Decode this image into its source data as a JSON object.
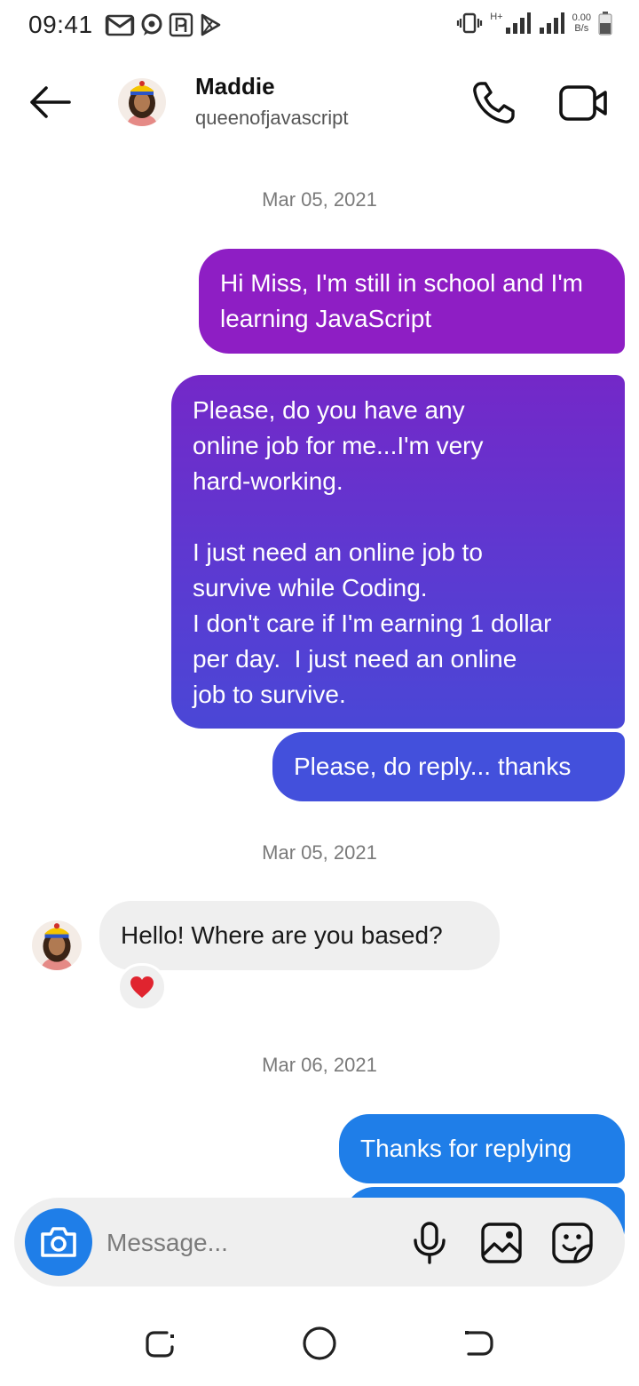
{
  "status_bar": {
    "time": "09:41",
    "data_speed_value": "0.00",
    "data_speed_unit": "B/s",
    "network_type": "H+",
    "left_icons": [
      "gmail-icon",
      "messenger-icon",
      "paypal-icon",
      "play-store-icon"
    ],
    "right_icons": [
      "vibrate-icon",
      "signal-icon",
      "signal-icon",
      "battery-icon"
    ]
  },
  "header": {
    "name": "Maddie",
    "username": "queenofjavascript",
    "icons": [
      "back-arrow-icon",
      "phone-icon",
      "video-icon"
    ]
  },
  "conversation": {
    "date_1": "Mar 05, 2021",
    "outgoing_1": "Hi Miss, I'm still in school and I'm learning JavaScript",
    "outgoing_2": "Please, do you have any\nonline job for me...I'm very\nhard-working.\n\nI just need an online job to\nsurvive while Coding.\nI don't care if I'm earning 1 dollar\nper day.  I just need an online\njob to survive.",
    "outgoing_3": "Please, do reply... thanks",
    "date_2": "Mar 05, 2021",
    "incoming_1": "Hello! Where are you based?",
    "reaction": "heart",
    "date_3": "Mar 06, 2021",
    "outgoing_4": "Thanks for replying"
  },
  "composer": {
    "placeholder": "Message...",
    "icons": [
      "camera-icon",
      "microphone-icon",
      "gallery-icon",
      "sticker-icon"
    ]
  },
  "colors": {
    "bubble_purple": "#8e1ec4",
    "bubble_violet": "#5a3bd2",
    "bubble_indigo": "#4350dc",
    "bubble_blue": "#1f7ee8",
    "incoming_bg": "#efefef",
    "reaction_heart": "#e0242f"
  }
}
